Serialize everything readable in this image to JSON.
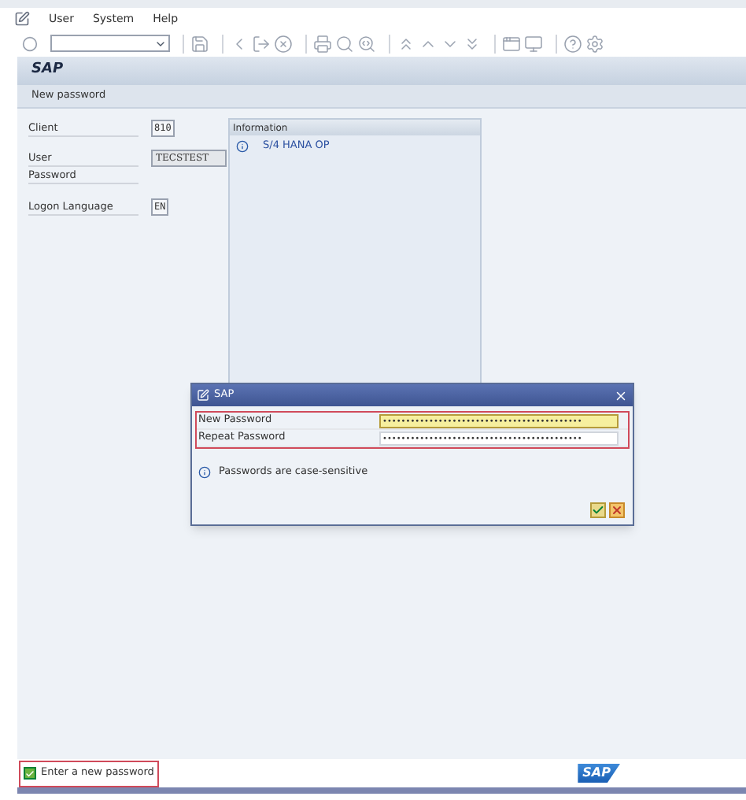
{
  "menu": [
    "User",
    "System",
    "Help"
  ],
  "header": {
    "title": "SAP",
    "subtitle": "New password"
  },
  "fields": [
    {
      "label": "Client",
      "value": "810",
      "kind": "short"
    },
    {
      "label": "User",
      "value": "TECSTEST",
      "kind": "wide"
    },
    {
      "label": "Password",
      "kind": "hidden"
    },
    {
      "label": "Logon Language",
      "value": "EN",
      "kind": "short"
    }
  ],
  "info_panel": {
    "title": "Information",
    "items": [
      "S/4 HANA OP"
    ]
  },
  "dialog": {
    "title": "SAP",
    "fields": [
      {
        "label": "New Password",
        "value": "•••••••••••••••••••••••••••••••••••••••••••",
        "focused": true
      },
      {
        "label": "Repeat Password",
        "value": "•••••••••••••••••••••••••••••••••••••••••••",
        "focused": false
      }
    ],
    "note": "Passwords are case-sensitive"
  },
  "status_bar": {
    "message": "Enter a new password",
    "checked": true,
    "logo": "SAP"
  }
}
